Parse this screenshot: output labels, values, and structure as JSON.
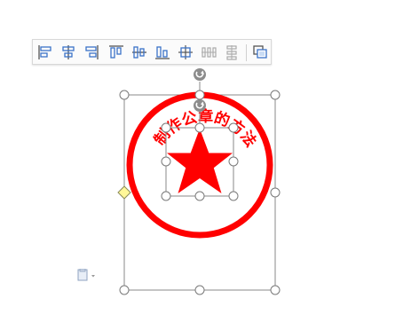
{
  "toolbar": {
    "buttons": [
      {
        "name": "align-left-icon"
      },
      {
        "name": "align-center-icon"
      },
      {
        "name": "align-right-icon"
      },
      {
        "name": "align-top-icon"
      },
      {
        "name": "align-middle-icon"
      },
      {
        "name": "align-bottom-icon"
      },
      {
        "name": "align-center-both-icon"
      },
      {
        "name": "distribute-horizontal-icon"
      },
      {
        "name": "distribute-vertical-icon"
      },
      {
        "name": "group-icon"
      }
    ]
  },
  "stamp": {
    "text": "制作公章的方法",
    "color": "#ff0000"
  },
  "colors": {
    "accent": "#3b73c8",
    "handle_stroke": "#7a7a7a",
    "rotate_handle": "#8c8c8c",
    "adjust_handle": "#fff799"
  }
}
